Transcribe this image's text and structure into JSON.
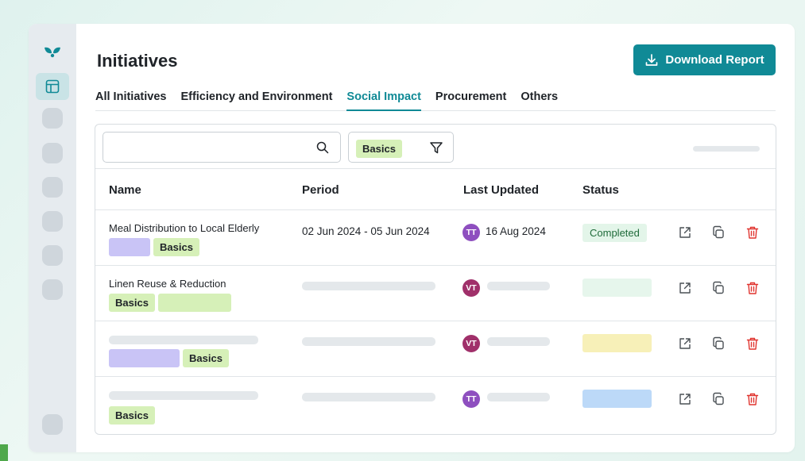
{
  "page": {
    "title": "Initiatives"
  },
  "header": {
    "download_label": "Download Report"
  },
  "tabs": [
    {
      "label": "All Initiatives"
    },
    {
      "label": "Efficiency and Environment"
    },
    {
      "label": "Social Impact",
      "active": true
    },
    {
      "label": "Procurement"
    },
    {
      "label": "Others"
    }
  ],
  "search": {
    "value": "",
    "placeholder": ""
  },
  "filter": {
    "chip": "Basics"
  },
  "table": {
    "columns": [
      "Name",
      "Period",
      "Last Updated",
      "Status"
    ],
    "rows": [
      {
        "name": "Meal Distribution to Local Elderly",
        "tag": "Basics",
        "period": "02 Jun 2024 - 05 Jun 2024",
        "avatar": "TT",
        "last_updated": "16 Aug 2024",
        "status": "Completed"
      },
      {
        "name": "Linen Reuse & Reduction",
        "tag": "Basics",
        "avatar": "VT"
      },
      {
        "tag": "Basics",
        "avatar": "VT"
      },
      {
        "tag": "Basics",
        "avatar": "TT"
      }
    ]
  },
  "colors": {
    "accent": "#108a96",
    "avatar_tt": "#8e4fbf",
    "avatar_vt": "#a0306a",
    "delete": "#e0342f",
    "status_yellow": "#f7f0b8",
    "status_blue": "#bcd9f8",
    "status_green_light": "#e6f6ec"
  },
  "icons": {
    "logo": "leaf-logo-icon",
    "nav": "table-grid-icon",
    "download": "download-icon",
    "search": "search-icon",
    "filter": "filter-icon",
    "open": "external-link-icon",
    "copy": "copy-icon",
    "delete": "trash-icon"
  }
}
